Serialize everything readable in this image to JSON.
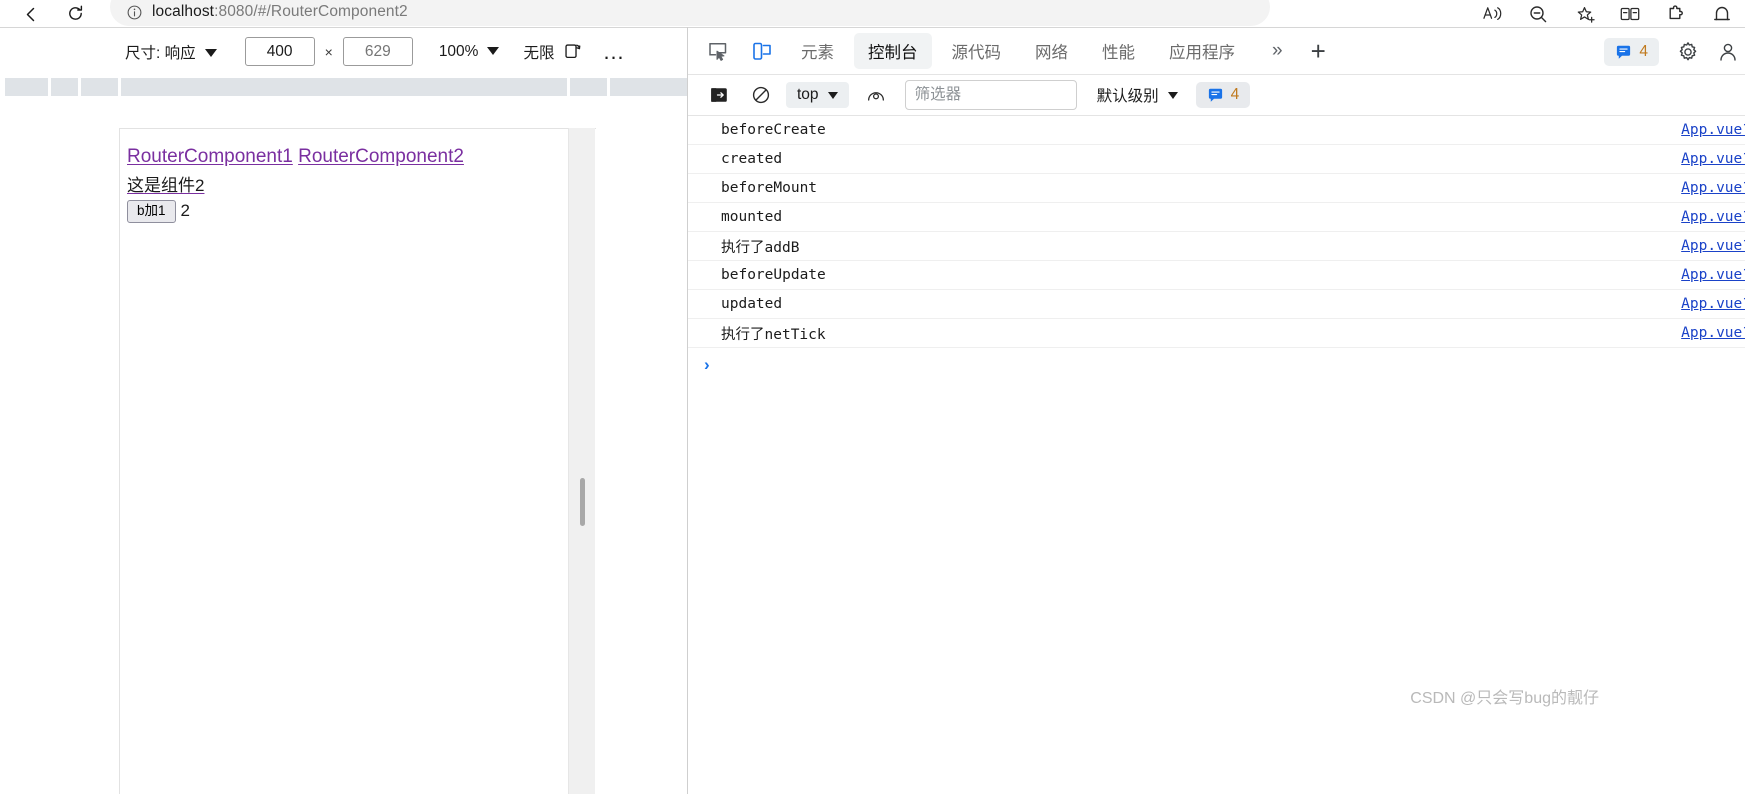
{
  "browser": {
    "back_icon": "back-arrow-icon",
    "reload_icon": "reload-icon",
    "info_icon": "info-circle-icon",
    "url_host": "localhost",
    "url_rest": ":8080/#/RouterComponent2",
    "toolbar_icons": [
      {
        "name": "read-aloud-icon"
      },
      {
        "name": "zoom-out-icon"
      },
      {
        "name": "favorites-add-icon"
      },
      {
        "name": "collections-icon"
      },
      {
        "name": "extensions-icon"
      },
      {
        "name": "browser-essentials-icon"
      }
    ]
  },
  "device_toolbar": {
    "size_label": "尺寸: 响应",
    "width_value": "400",
    "height_placeholder": "629",
    "times": "×",
    "zoom_label": "100%",
    "throttle_label": "无限制",
    "rotate_icon": "rotate-device-icon",
    "more_options": "…"
  },
  "page": {
    "links": [
      {
        "label": "RouterComponent1"
      },
      {
        "label": "RouterComponent2"
      }
    ],
    "component_text": "这是组件2",
    "button_label": "b加1",
    "counter_value": "2"
  },
  "devtools": {
    "inspect_icon": "inspect-element-icon",
    "device_toggle_icon": "toggle-device-toolbar-icon",
    "tabs": [
      {
        "label": "元素",
        "selected": false
      },
      {
        "label": "控制台",
        "selected": true
      },
      {
        "label": "源代码",
        "selected": false
      },
      {
        "label": "网络",
        "selected": false
      },
      {
        "label": "性能",
        "selected": false
      },
      {
        "label": "应用程序",
        "selected": false
      }
    ],
    "more_tabs_icon": "chevron-double-right-icon",
    "add_panel_icon": "plus-icon",
    "message_badge": {
      "icon": "console-message-icon",
      "count": "4"
    },
    "settings_icon": "gear-icon",
    "profile_icon": "person-icon"
  },
  "console": {
    "sidebar_icon": "console-sidebar-icon",
    "clear_icon": "clear-console-icon",
    "context": "top",
    "eye_icon": "live-expression-icon",
    "filter_placeholder": "筛选器",
    "level_label": "默认级别",
    "badge": {
      "icon": "console-message-icon",
      "count": "4"
    },
    "prompt_arrow": "›",
    "messages": [
      {
        "text": "beforeCreate",
        "lang": "en",
        "source": "App.vue?"
      },
      {
        "text": "created",
        "lang": "en",
        "source": "App.vue?"
      },
      {
        "text": "beforeMount",
        "lang": "en",
        "source": "App.vue?"
      },
      {
        "text": "mounted",
        "lang": "en",
        "source": "App.vue?"
      },
      {
        "text": "执行了addB",
        "lang": "cn",
        "source": "App.vue?"
      },
      {
        "text": "beforeUpdate",
        "lang": "en",
        "source": "App.vue?"
      },
      {
        "text": "updated",
        "lang": "en",
        "source": "App.vue?"
      },
      {
        "text": "执行了netTick",
        "lang": "cn",
        "source": "App.vue?"
      }
    ]
  },
  "watermark": "CSDN @只会写bug的靓仔",
  "colors": {
    "accent_blue": "#1a73e8",
    "link_purple": "#7a2fa0",
    "source_link": "#1a42c8",
    "badge_amber": "#c07a1e"
  }
}
